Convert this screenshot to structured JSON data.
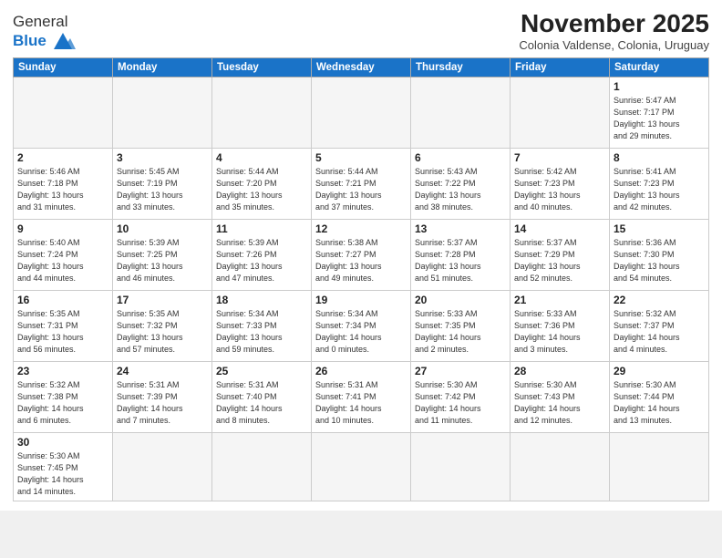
{
  "header": {
    "logo_general": "General",
    "logo_blue": "Blue",
    "month_title": "November 2025",
    "subtitle": "Colonia Valdense, Colonia, Uruguay"
  },
  "days_of_week": [
    "Sunday",
    "Monday",
    "Tuesday",
    "Wednesday",
    "Thursday",
    "Friday",
    "Saturday"
  ],
  "weeks": [
    [
      {
        "day": "",
        "info": ""
      },
      {
        "day": "",
        "info": ""
      },
      {
        "day": "",
        "info": ""
      },
      {
        "day": "",
        "info": ""
      },
      {
        "day": "",
        "info": ""
      },
      {
        "day": "",
        "info": ""
      },
      {
        "day": "1",
        "info": "Sunrise: 5:47 AM\nSunset: 7:17 PM\nDaylight: 13 hours\nand 29 minutes."
      }
    ],
    [
      {
        "day": "2",
        "info": "Sunrise: 5:46 AM\nSunset: 7:18 PM\nDaylight: 13 hours\nand 31 minutes."
      },
      {
        "day": "3",
        "info": "Sunrise: 5:45 AM\nSunset: 7:19 PM\nDaylight: 13 hours\nand 33 minutes."
      },
      {
        "day": "4",
        "info": "Sunrise: 5:44 AM\nSunset: 7:20 PM\nDaylight: 13 hours\nand 35 minutes."
      },
      {
        "day": "5",
        "info": "Sunrise: 5:44 AM\nSunset: 7:21 PM\nDaylight: 13 hours\nand 37 minutes."
      },
      {
        "day": "6",
        "info": "Sunrise: 5:43 AM\nSunset: 7:22 PM\nDaylight: 13 hours\nand 38 minutes."
      },
      {
        "day": "7",
        "info": "Sunrise: 5:42 AM\nSunset: 7:23 PM\nDaylight: 13 hours\nand 40 minutes."
      },
      {
        "day": "8",
        "info": "Sunrise: 5:41 AM\nSunset: 7:23 PM\nDaylight: 13 hours\nand 42 minutes."
      }
    ],
    [
      {
        "day": "9",
        "info": "Sunrise: 5:40 AM\nSunset: 7:24 PM\nDaylight: 13 hours\nand 44 minutes."
      },
      {
        "day": "10",
        "info": "Sunrise: 5:39 AM\nSunset: 7:25 PM\nDaylight: 13 hours\nand 46 minutes."
      },
      {
        "day": "11",
        "info": "Sunrise: 5:39 AM\nSunset: 7:26 PM\nDaylight: 13 hours\nand 47 minutes."
      },
      {
        "day": "12",
        "info": "Sunrise: 5:38 AM\nSunset: 7:27 PM\nDaylight: 13 hours\nand 49 minutes."
      },
      {
        "day": "13",
        "info": "Sunrise: 5:37 AM\nSunset: 7:28 PM\nDaylight: 13 hours\nand 51 minutes."
      },
      {
        "day": "14",
        "info": "Sunrise: 5:37 AM\nSunset: 7:29 PM\nDaylight: 13 hours\nand 52 minutes."
      },
      {
        "day": "15",
        "info": "Sunrise: 5:36 AM\nSunset: 7:30 PM\nDaylight: 13 hours\nand 54 minutes."
      }
    ],
    [
      {
        "day": "16",
        "info": "Sunrise: 5:35 AM\nSunset: 7:31 PM\nDaylight: 13 hours\nand 56 minutes."
      },
      {
        "day": "17",
        "info": "Sunrise: 5:35 AM\nSunset: 7:32 PM\nDaylight: 13 hours\nand 57 minutes."
      },
      {
        "day": "18",
        "info": "Sunrise: 5:34 AM\nSunset: 7:33 PM\nDaylight: 13 hours\nand 59 minutes."
      },
      {
        "day": "19",
        "info": "Sunrise: 5:34 AM\nSunset: 7:34 PM\nDaylight: 14 hours\nand 0 minutes."
      },
      {
        "day": "20",
        "info": "Sunrise: 5:33 AM\nSunset: 7:35 PM\nDaylight: 14 hours\nand 2 minutes."
      },
      {
        "day": "21",
        "info": "Sunrise: 5:33 AM\nSunset: 7:36 PM\nDaylight: 14 hours\nand 3 minutes."
      },
      {
        "day": "22",
        "info": "Sunrise: 5:32 AM\nSunset: 7:37 PM\nDaylight: 14 hours\nand 4 minutes."
      }
    ],
    [
      {
        "day": "23",
        "info": "Sunrise: 5:32 AM\nSunset: 7:38 PM\nDaylight: 14 hours\nand 6 minutes."
      },
      {
        "day": "24",
        "info": "Sunrise: 5:31 AM\nSunset: 7:39 PM\nDaylight: 14 hours\nand 7 minutes."
      },
      {
        "day": "25",
        "info": "Sunrise: 5:31 AM\nSunset: 7:40 PM\nDaylight: 14 hours\nand 8 minutes."
      },
      {
        "day": "26",
        "info": "Sunrise: 5:31 AM\nSunset: 7:41 PM\nDaylight: 14 hours\nand 10 minutes."
      },
      {
        "day": "27",
        "info": "Sunrise: 5:30 AM\nSunset: 7:42 PM\nDaylight: 14 hours\nand 11 minutes."
      },
      {
        "day": "28",
        "info": "Sunrise: 5:30 AM\nSunset: 7:43 PM\nDaylight: 14 hours\nand 12 minutes."
      },
      {
        "day": "29",
        "info": "Sunrise: 5:30 AM\nSunset: 7:44 PM\nDaylight: 14 hours\nand 13 minutes."
      }
    ],
    [
      {
        "day": "30",
        "info": "Sunrise: 5:30 AM\nSunset: 7:45 PM\nDaylight: 14 hours\nand 14 minutes."
      },
      {
        "day": "",
        "info": ""
      },
      {
        "day": "",
        "info": ""
      },
      {
        "day": "",
        "info": ""
      },
      {
        "day": "",
        "info": ""
      },
      {
        "day": "",
        "info": ""
      },
      {
        "day": "",
        "info": ""
      }
    ]
  ]
}
